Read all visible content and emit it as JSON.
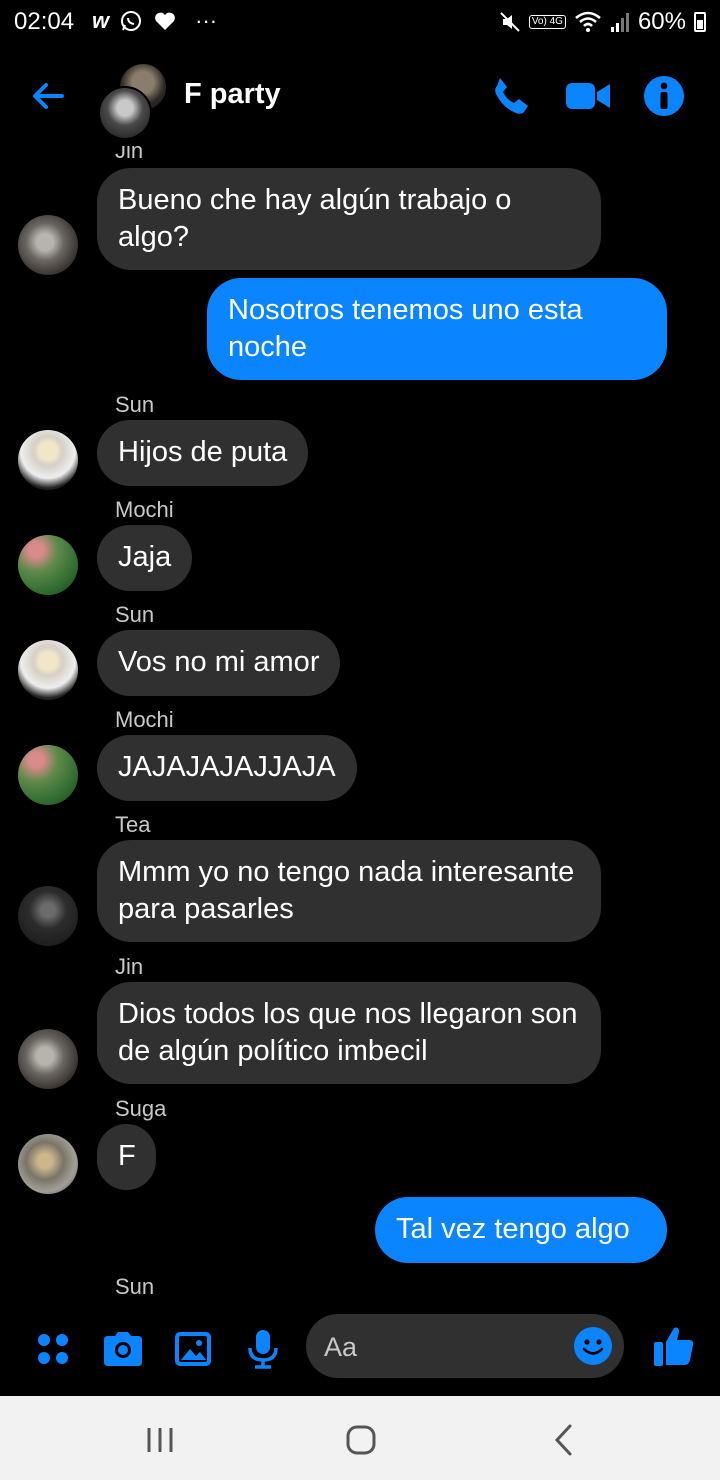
{
  "status_bar": {
    "time": "02:04",
    "left_icons": [
      "w-icon",
      "whatsapp-icon",
      "heart-icon",
      "more-icon"
    ],
    "volte": "Vo) 4G",
    "battery": "60%"
  },
  "header": {
    "title": "F party"
  },
  "messages": [
    {
      "sender": "Jin",
      "text": "Bueno che hay algún trabajo o algo?",
      "direction": "in"
    },
    {
      "sender": "",
      "text": "Nosotros tenemos uno esta noche",
      "direction": "out"
    },
    {
      "sender": "Sun",
      "text": "Hijos de puta",
      "direction": "in"
    },
    {
      "sender": "Mochi",
      "text": "Jaja",
      "direction": "in"
    },
    {
      "sender": "Sun",
      "text": "Vos no mi amor",
      "direction": "in"
    },
    {
      "sender": "Mochi",
      "text": "JAJAJAJAJJAJA",
      "direction": "in"
    },
    {
      "sender": "Tea",
      "text": "Mmm yo no tengo nada interesante para pasarles",
      "direction": "in"
    },
    {
      "sender": "Jin",
      "text": "Dios todos los que nos llegaron son de algún político imbecil",
      "direction": "in"
    },
    {
      "sender": "Suga",
      "text": "F",
      "direction": "in"
    },
    {
      "sender": "",
      "text": "Tal vez tengo algo",
      "direction": "out"
    },
    {
      "sender": "Sun",
      "text": "",
      "direction": "in"
    }
  ],
  "composer": {
    "placeholder": "Aa"
  },
  "colors": {
    "accent": "#0a84ff",
    "incoming_bubble": "#303030",
    "background": "#000000"
  }
}
